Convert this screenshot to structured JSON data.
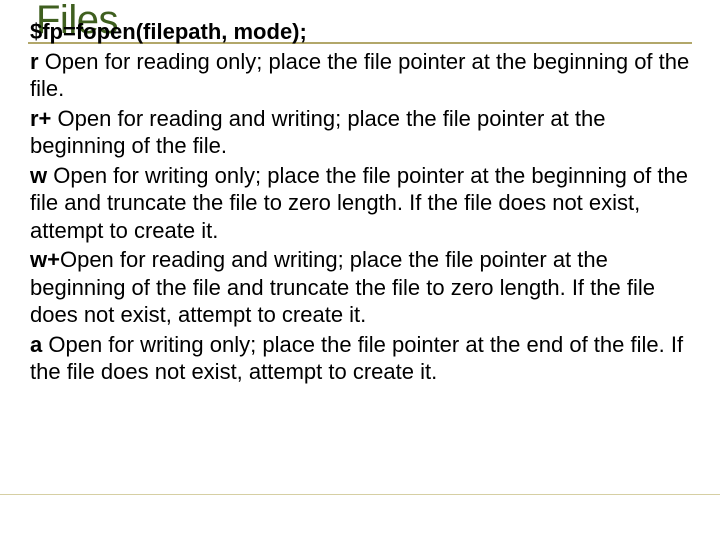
{
  "slide": {
    "title": "Files",
    "syntax": "$fp=fopen(filepath, mode);",
    "modes": [
      {
        "label": "r ",
        "desc": "  Open for reading only; place the file pointer at the beginning of the file."
      },
      {
        "label": "r+",
        "desc": " Open for reading and writing; place the file pointer at the beginning of the file."
      },
      {
        "label": "w ",
        "desc": " Open for writing only; place the file pointer at the beginning of the file and truncate the file to zero length. If the file does not exist, attempt to create it."
      },
      {
        "label": "w+",
        "desc": "Open for reading and writing; place the file pointer at the beginning of the file and truncate the file to zero length. If the file does not exist, attempt to create it."
      },
      {
        "label": "a ",
        "desc": "  Open for writing only; place the file pointer at the end of the file. If the file does not exist, attempt to create it."
      }
    ]
  }
}
